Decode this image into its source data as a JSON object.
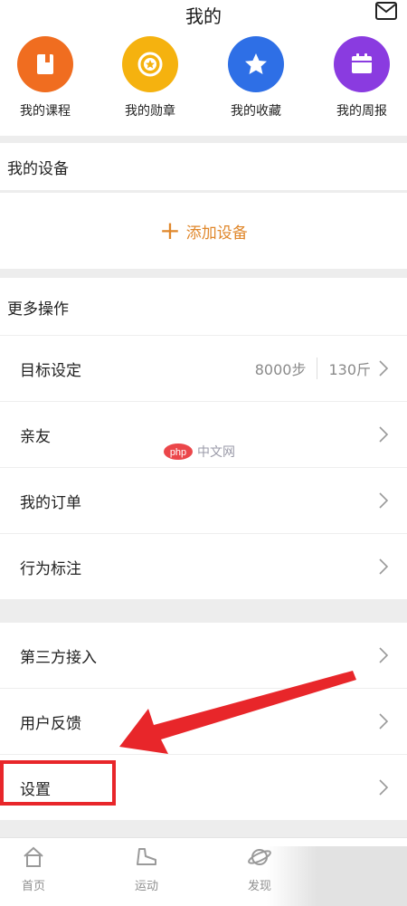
{
  "header": {
    "title": "我的",
    "mail_icon": "mail-icon",
    "shortcuts": [
      {
        "label": "我的课程",
        "icon": "course-icon",
        "color": "#f06d20"
      },
      {
        "label": "我的勋章",
        "icon": "medal-icon",
        "color": "#f5b20f"
      },
      {
        "label": "我的收藏",
        "icon": "star-icon",
        "color": "#2e6fe6"
      },
      {
        "label": "我的周报",
        "icon": "calendar-icon",
        "color": "#8a3be0"
      }
    ]
  },
  "devices": {
    "title": "我的设备",
    "add_label": "添加设备",
    "add_icon": "plus-icon",
    "accent": "#e0872b"
  },
  "more": {
    "title": "更多操作",
    "goal": {
      "label": "目标设定",
      "steps": "8000步",
      "weight": "130斤"
    },
    "items": [
      {
        "label": "亲友"
      },
      {
        "label": "我的订单"
      },
      {
        "label": "行为标注"
      }
    ]
  },
  "misc": {
    "items": [
      {
        "label": "第三方接入"
      },
      {
        "label": "用户反馈"
      },
      {
        "label": "设置"
      }
    ],
    "highlight_color": "#e8262a"
  },
  "tabbar": {
    "tabs": [
      {
        "label": "首页",
        "icon": "home-icon"
      },
      {
        "label": "运动",
        "icon": "shoe-icon"
      },
      {
        "label": "发现",
        "icon": "planet-icon"
      }
    ]
  },
  "watermark": {
    "brand": "php",
    "text": "中文网"
  }
}
